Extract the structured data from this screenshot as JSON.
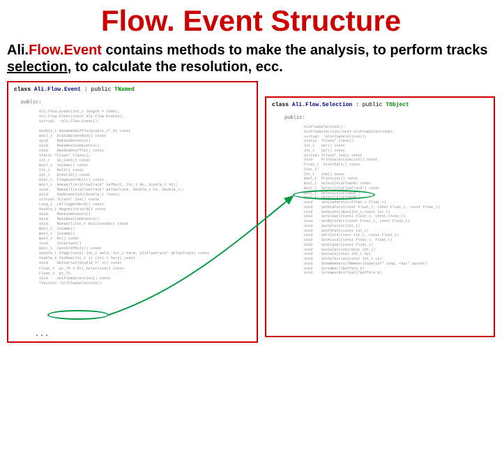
{
  "title": "Flow. Event Structure",
  "subtitle": {
    "t1": "Ali.",
    "t2": "Flow.Event",
    "t3": " contains methods to make the analysis, to perform tracks ",
    "t4": "selection",
    "t5": ", to calculate the resolution, ecc."
  },
  "left_panel": {
    "decl_kw_class": "class ",
    "decl_name": "Ali.Flow.Event",
    "decl_sep": " : public ",
    "decl_base": "TNamed",
    "access": "public:",
    "code": "Ali.Flow.Event(Int_t length = 2000);\nAli.Flow.Event(const Ali.Flow.Event&);\nvirtual  ~Ali.Flow.Event();\n\nDouble_t RandomShuffle(Double_t* d) const\nBool_t  EtaSubEventRun() const\nvoid    MakeSubEvents()\nvoid    MakeRealSubEvents()\nvoid    RandomShuffle() const\nstatic TClass* Class();\nInt_t   Se_Cent() const\nBool_t  IsSame() const\nInt_t   Mult() const\nInt_t   EventID() const\nUInt_t  FlowEventMult() const\nBool_t  MakeAll(AliFlowTrack* defMult, Int_t Nc, Double_t Pt);\nvoid    MakeAll(AliFlowTrack* pFlowTrack, Double_t Pt, Double_t);\nvoid    AddEventInfo(Double_t *cent)\nvirtual TClass* IsA() const\nLong_t  L0TriggerWord() const\nDouble_t MagneticField() const\nvoid    MakeSubEvents()\nvoid    MakeRealSubEvents()\nvoid    Makeall(Int_t multintodet) const\nBool_t  IsSame()\nBool_t  IsSame()\nBool_t  Mc() const\nvoid    Invariant()\nBool_t  CenterOfMult() const\nDouble_t PtWgt(const Int_t sel4, Int_t harN, AliFlowTrack* pFlowTrack) const\nDouble_t PsiRaw(Int_t i) (Int_t harz) const\nvoid    GetVertex(Double_t* vt) const\nFloat_t  pt_Th = Ptl.Selection() const\nFloat_t  pt_Th\nvoid    SetFlowSelection() const\nTVector2 *AllFlowSelection()",
    "ellipsis": "..."
  },
  "right_panel": {
    "decl_kw_class": "class ",
    "decl_name": "Ali.Flow.Selection",
    "decl_sep": " : public ",
    "decl_base": "TObject",
    "access": "public:",
    "code": "AliFlowSelection();\nAliFlowSelection(const AliFlowSelection&);\nvirtual  ~AliFlowSelection();\nstatic  TClass* Class()\nInt_t   Har() const\nInt_t   Sel() const\nvirtual TClass* IsA() const\nvoid    PrintSelectionList() const\nFloat_t  PtSelPart() const\nChar_t*\nInt_t   Sub() const\nBool_t  PrintList() const\nBool_t  Select(AliFlowVN) const\nBool_t  Select(AliFlowTrack*) const\nBool_t  Select(AliFlowV0*)\nBool_t  Select(AliFlowVN*)\nvoid    SetEtaPartCut(Float_t Float_t)\nvoid    SetDcaCuts(const Float_t, const Float_t, const Float_t)\nvoid    SetDcaPoolRun(Int_t,const Int_t)\nvoid    SetEtaSel(const Float_t, const Float_t)\nvoid    SetMultPart(const Float_t, const Float_t)\nvoid    SetSelector(Int_t)\nvoid    SetPtPart(const Int_t)\nvoid    SetYCuts(const Int_t, const Float_t)\nvoid    SetPLocal(const Float_t, Float_t)\nvoid    SetEtaSel(const Float_t)\nvoid    SetSelection(const Int_t)\nvoid    SetCuts(const Int_t kp)\nvoid    SetSelection(const Int_t cs)\nvoid    ShowMembers(TMemberInspector* insp, char* parent)\nvoid    Streamer(TBuffer& b)\nvoid    StreamerNVirtual(TBuffer& b)"
  }
}
